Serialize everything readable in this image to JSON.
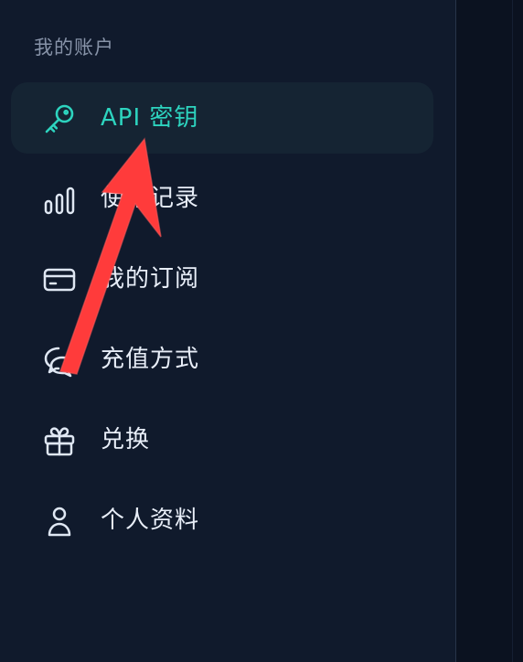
{
  "sidebar": {
    "section_title": "我的账户",
    "items": [
      {
        "label": "API 密钥",
        "icon": "key-icon",
        "active": true
      },
      {
        "label": "使用记录",
        "icon": "bar-chart-icon",
        "active": false
      },
      {
        "label": "我的订阅",
        "icon": "credit-card-icon",
        "active": false
      },
      {
        "label": "充值方式",
        "icon": "chat-bubbles-icon",
        "active": false
      },
      {
        "label": "兑换",
        "icon": "gift-icon",
        "active": false
      },
      {
        "label": "个人资料",
        "icon": "user-icon",
        "active": false
      }
    ]
  },
  "colors": {
    "background": "#101a2c",
    "active_background": "#152433",
    "accent": "#2dd4bf",
    "text": "#e8eef8",
    "muted_text": "#8793a8",
    "annotation": "#ff3b3b"
  }
}
